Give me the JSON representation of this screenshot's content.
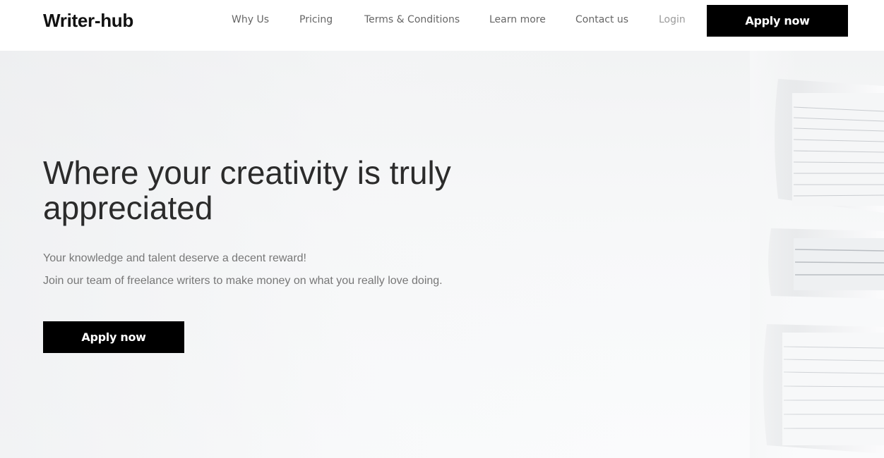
{
  "header": {
    "logo": "Writer-hub",
    "nav": [
      {
        "label": "Why Us"
      },
      {
        "label": "Pricing"
      },
      {
        "label": "Terms & Conditions"
      },
      {
        "label": "Learn more"
      },
      {
        "label": "Contact us"
      },
      {
        "label": "Login"
      }
    ],
    "cta_label": "Apply now"
  },
  "hero": {
    "title": "Where your creativity is truly appreciated",
    "subtitle_line1": "Your knowledge and talent deserve a decent reward!",
    "subtitle_line2": "Join our team of freelance writers to make money on what you really love doing.",
    "cta_label": "Apply now",
    "image": "book-stack-image"
  },
  "colors": {
    "button_bg": "#000000",
    "button_text": "#ffffff",
    "nav_text": "#666666",
    "title_text": "#2b2b2b",
    "body_text": "#777777"
  }
}
